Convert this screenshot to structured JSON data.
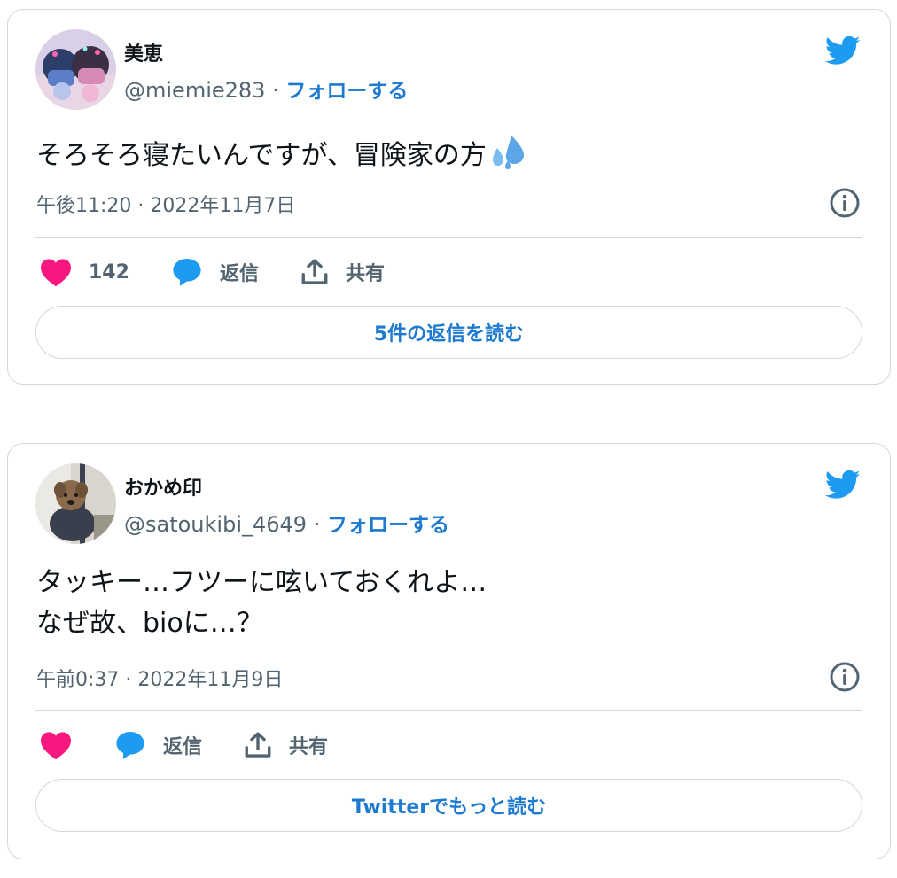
{
  "tweets": [
    {
      "display_name": "美恵",
      "handle": "@miemie283",
      "separator": "·",
      "follow_label": "フォローする",
      "text_lines": [
        "そろそろ寝たいんですが、冒険家の方"
      ],
      "emoji": "sweat-droplets-icon",
      "timestamp": "午後11:20 · 2022年11月7日",
      "like_count": "142",
      "reply_label": "返信",
      "share_label": "共有",
      "cta_label": "5件の返信を読む"
    },
    {
      "display_name": "おかめ印",
      "handle": "@satoukibi_4649",
      "separator": "·",
      "follow_label": "フォローする",
      "text_lines": [
        "タッキー…フツーに呟いておくれよ…",
        "なぜ故、bioに…？"
      ],
      "timestamp": "午前0:37 · 2022年11月9日",
      "like_count": "",
      "reply_label": "返信",
      "share_label": "共有",
      "cta_label": "Twitterでもっと読む"
    }
  ],
  "colors": {
    "twitter_blue": "#1d9bf0",
    "link_blue": "#1d7ad0",
    "like_pink": "#f91880",
    "text_secondary": "#536471",
    "border": "#cfd9de"
  }
}
